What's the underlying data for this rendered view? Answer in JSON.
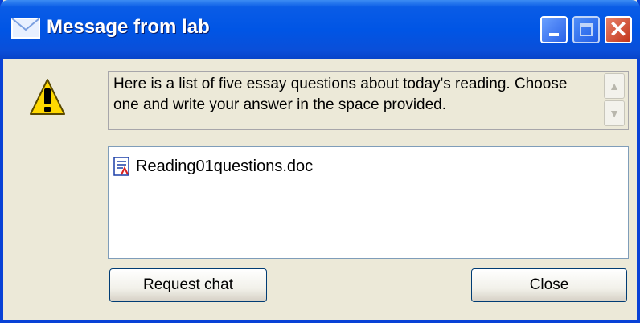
{
  "window": {
    "title": "Message from lab"
  },
  "message": {
    "text": "Here is a list of five essay questions about today's reading. Choose one and write your answer in the space provided."
  },
  "attachments": [
    {
      "name": "Reading01questions.doc"
    }
  ],
  "buttons": {
    "request_chat": "Request chat",
    "close": "Close"
  },
  "icons": {
    "title": "envelope-icon",
    "message": "warning-icon",
    "file": "document-icon"
  },
  "colors": {
    "titlebar": "#0055e5",
    "window_bg": "#ece9d8",
    "close_button": "#c2351a"
  }
}
